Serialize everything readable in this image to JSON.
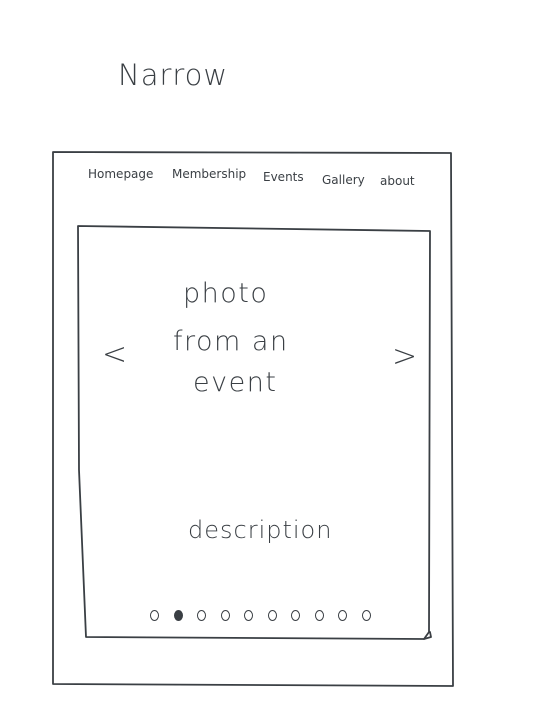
{
  "page": {
    "heading": "Narrow"
  },
  "nav": {
    "items": [
      {
        "label": "Homepage"
      },
      {
        "label": "Membership"
      },
      {
        "label": "Events"
      },
      {
        "label": "Gallery"
      },
      {
        "label": "about"
      }
    ]
  },
  "carousel": {
    "prev_arrow": "<",
    "next_arrow": ">",
    "photo_lines": [
      "photo",
      "from an",
      "event"
    ],
    "description": "description",
    "slide_count": 10,
    "active_slide": 2
  },
  "colors": {
    "ink": "#3a3f44",
    "background": "#ffffff"
  }
}
